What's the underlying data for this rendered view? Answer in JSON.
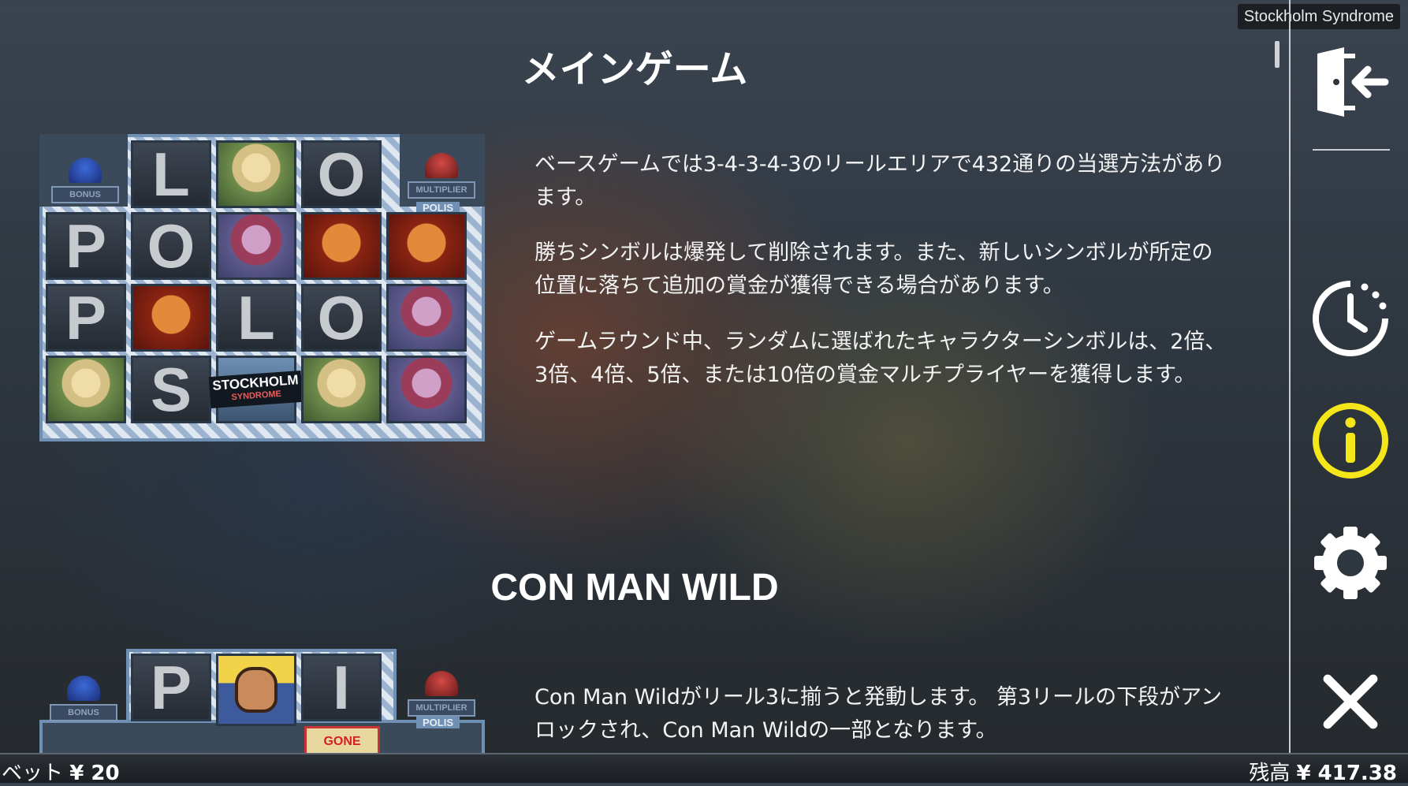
{
  "window": {
    "title": "Stockholm Syndrome"
  },
  "main_game": {
    "heading": "メインゲーム",
    "paragraphs": [
      "ベースゲームでは3-4-3-4-3のリールエリアで432通りの当選方法があります。",
      "勝ちシンボルは爆発して削除されます。また、新しいシンボルが所定の位置に落ちて追加の賞金が獲得できる場合があります。",
      "ゲームラウンド中、ランダムに選ばれたキャラクターシンボルは、2倍、3倍、4倍、5倍、または10倍の賞金マルチプライヤーを獲得します。"
    ],
    "reel_letters": {
      "r0": [
        "L",
        "O"
      ],
      "r1": [
        "P",
        "O"
      ],
      "r2": [
        "P",
        "L",
        "O"
      ],
      "r3": [
        "S"
      ]
    },
    "logo": {
      "line1": "STOCKHOLM",
      "line2": "SYNDROME"
    },
    "bonus_label": "BONUS",
    "multiplier_label": "MULTIPLIER",
    "polis_label": "POLIS"
  },
  "con_man_wild": {
    "heading": "CON MAN WILD",
    "paragraph": "Con Man Wildがリール3に揃うと発動します。 第3リールの下段がアンロックされ、Con Man Wildの一部となります。",
    "reel_letters": [
      "P",
      "I"
    ],
    "bonus_label": "BONUS",
    "multiplier_label": "MULTIPLIER",
    "polis_label": "POLIS",
    "gone_label": "GONE"
  },
  "sidebar": {
    "icons": [
      "exit-icon",
      "history-icon",
      "info-icon",
      "settings-icon",
      "close-icon"
    ],
    "info_color": "#f5e61a"
  },
  "footer": {
    "bet_label": "ベット",
    "bet_value": "¥ 20",
    "balance_label": "残高",
    "balance_value": "¥ 417.38"
  }
}
